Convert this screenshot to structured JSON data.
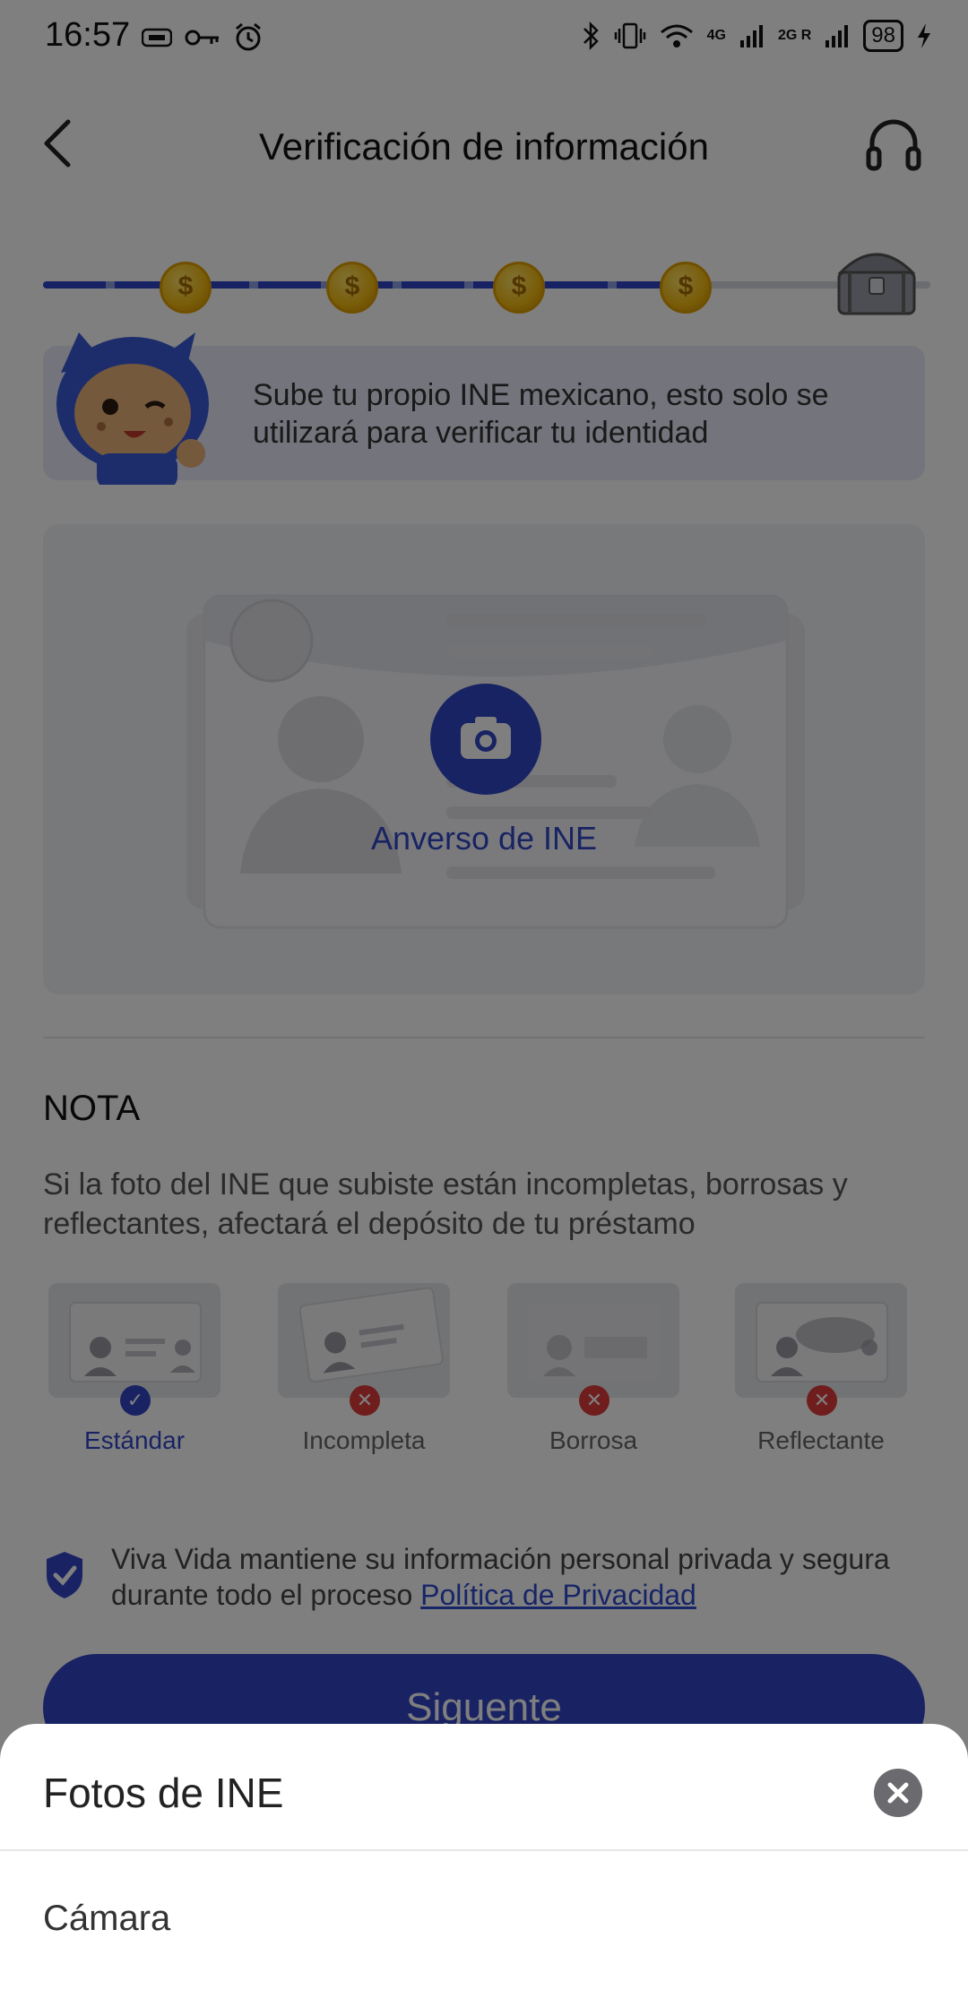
{
  "status_bar": {
    "time": "16:57",
    "battery": "98",
    "network_a": "4G",
    "network_b": "2G R"
  },
  "header": {
    "title": "Verificación de información"
  },
  "progress": {
    "coin_symbol": "$",
    "completed_fraction": 0.72
  },
  "banner": {
    "text": "Sube tu propio INE mexicano, esto solo se utilizará para verificar tu identidad"
  },
  "upload": {
    "label": "Anverso de INE"
  },
  "note": {
    "title": "NOTA",
    "description": "Si la foto del INE que subiste están incompletas, borrosas y reflectantes, afectará el depósito de tu préstamo",
    "samples": [
      {
        "label": "Estándar",
        "status": "ok"
      },
      {
        "label": "Incompleta",
        "status": "error"
      },
      {
        "label": "Borrosa",
        "status": "error"
      },
      {
        "label": "Reflectante",
        "status": "error"
      }
    ]
  },
  "privacy": {
    "text": "Viva Vida mantiene su información personal privada y segura durante todo el proceso ",
    "link": "Política de Privacidad"
  },
  "next_button": {
    "label": "Siguente"
  },
  "sheet": {
    "title": "Fotos de INE",
    "option_camera": "Cámara"
  },
  "colors": {
    "primary": "#3347c9",
    "accent_link": "#2f4bd0",
    "error": "#e03a3a",
    "coin": "#f2b90f"
  }
}
